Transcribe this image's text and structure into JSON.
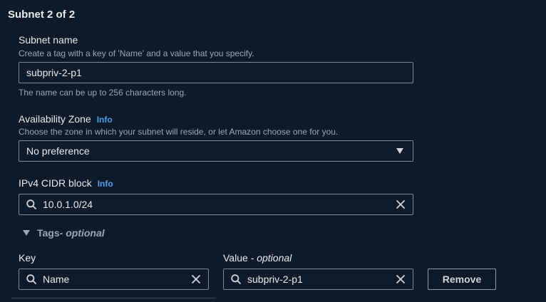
{
  "section": {
    "title": "Subnet 2 of 2"
  },
  "subnet_name": {
    "label": "Subnet name",
    "description": "Create a tag with a key of 'Name' and a value that you specify.",
    "value": "subpriv-2-p1",
    "constraint": "The name can be up to 256 characters long."
  },
  "availability_zone": {
    "label": "Availability Zone",
    "info": "Info",
    "description": "Choose the zone in which your subnet will reside, or let Amazon choose one for you.",
    "selected": "No preference"
  },
  "cidr": {
    "label": "IPv4 CIDR block",
    "info": "Info",
    "value": "10.0.1.0/24"
  },
  "tags": {
    "toggle_label": "Tags",
    "toggle_suffix": " - optional",
    "key_label": "Key",
    "value_label": "Value",
    "value_suffix": " - optional",
    "key_value": "Name",
    "value_value": "subpriv-2-p1",
    "remove_label": "Remove"
  },
  "colors": {
    "background": "#0e1a29",
    "border": "#7d8998",
    "link": "#539fe5",
    "text": "#e9ebed",
    "muted": "#9ba7b6"
  }
}
